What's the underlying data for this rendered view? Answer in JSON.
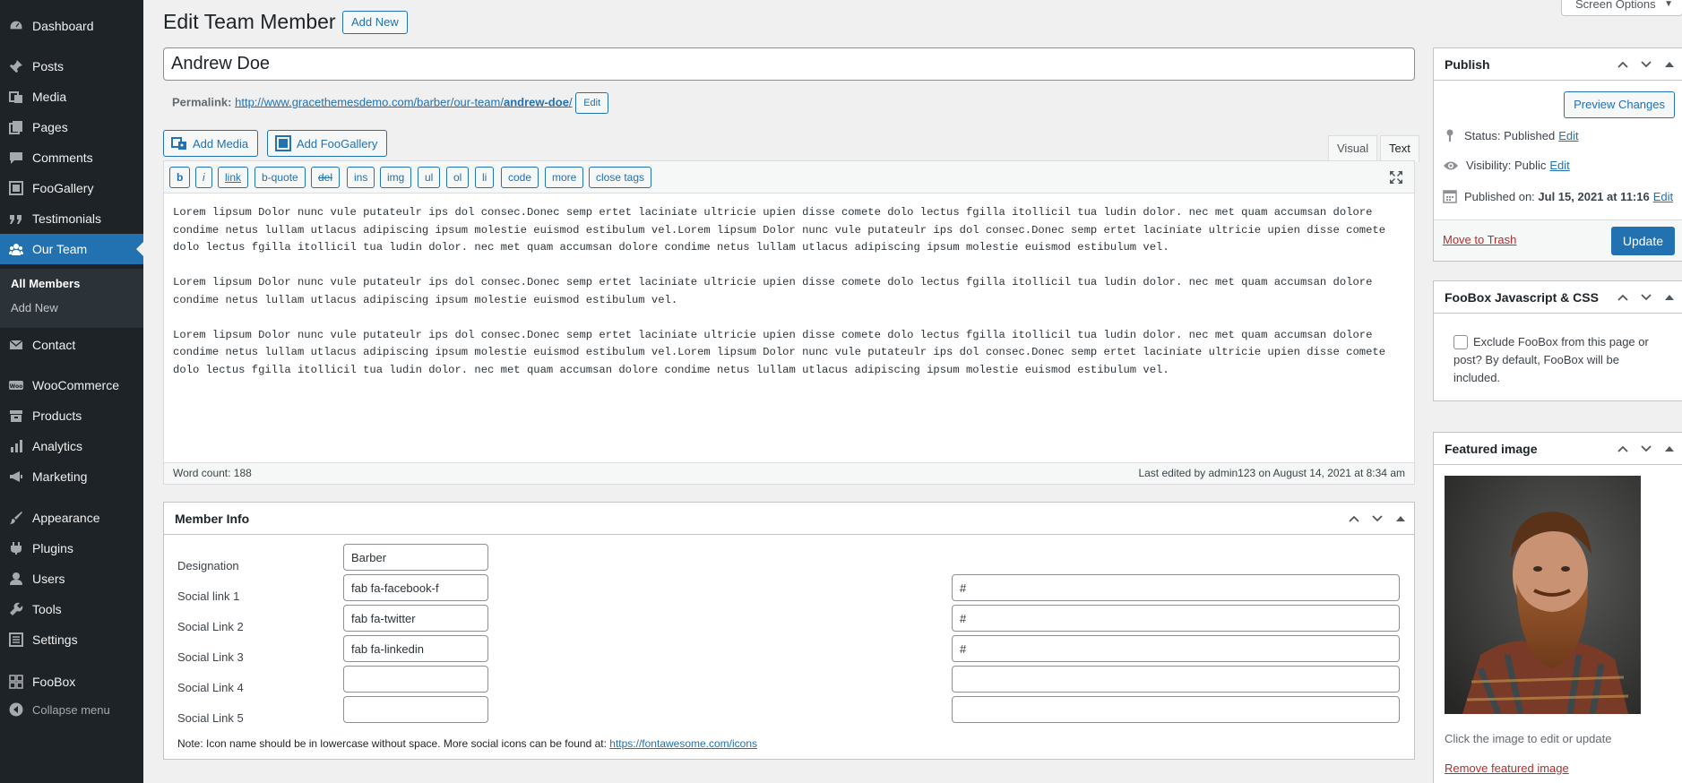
{
  "sidebar": {
    "items": [
      {
        "label": "Dashboard",
        "icon": "dashboard-icon"
      },
      {
        "label": "Posts",
        "icon": "pin-icon"
      },
      {
        "label": "Media",
        "icon": "media-icon"
      },
      {
        "label": "Pages",
        "icon": "page-icon"
      },
      {
        "label": "Comments",
        "icon": "comment-icon"
      },
      {
        "label": "FooGallery",
        "icon": "gallery-icon"
      },
      {
        "label": "Testimonials",
        "icon": "quote-icon"
      },
      {
        "label": "Our Team",
        "icon": "group-icon"
      },
      {
        "label": "Contact",
        "icon": "mail-icon"
      },
      {
        "label": "WooCommerce",
        "icon": "woo-icon"
      },
      {
        "label": "Products",
        "icon": "archive-icon"
      },
      {
        "label": "Analytics",
        "icon": "chart-bar-icon"
      },
      {
        "label": "Marketing",
        "icon": "megaphone-icon"
      },
      {
        "label": "Appearance",
        "icon": "brush-icon"
      },
      {
        "label": "Plugins",
        "icon": "plugin-icon"
      },
      {
        "label": "Users",
        "icon": "user-icon"
      },
      {
        "label": "Tools",
        "icon": "wrench-icon"
      },
      {
        "label": "Settings",
        "icon": "settings-icon"
      },
      {
        "label": "FooBox",
        "icon": "grid-icon"
      }
    ],
    "submenu": {
      "all_members": "All Members",
      "add_new": "Add New"
    },
    "collapse": "Collapse menu"
  },
  "header": {
    "title": "Edit Team Member",
    "add_new": "Add New",
    "screen_options": "Screen Options"
  },
  "post": {
    "title": "Andrew Doe",
    "permalink_label": "Permalink:",
    "permalink_base": "http://www.gracethemesdemo.com/barber/our-team/",
    "permalink_slug": "andrew-doe",
    "permalink_tail": "/",
    "edit": "Edit"
  },
  "media_buttons": {
    "add_media": "Add Media",
    "add_foogallery": "Add FooGallery"
  },
  "editor": {
    "tabs": {
      "visual": "Visual",
      "text": "Text"
    },
    "quicktags": [
      "b",
      "i",
      "link",
      "b-quote",
      "del",
      "ins",
      "img",
      "ul",
      "ol",
      "li",
      "code",
      "more",
      "close tags"
    ],
    "paragraphs": [
      "Lorem lipsum Dolor nunc vule putateulr ips dol consec.Donec semp ertet laciniate ultricie upien disse comete dolo lectus fgilla itollicil tua ludin dolor. nec met quam accumsan dolore condime netus lullam utlacus adipiscing ipsum molestie euismod estibulum vel.Lorem lipsum Dolor nunc vule putateulr ips dol consec.Donec semp ertet laciniate ultricie upien disse comete dolo lectus fgilla itollicil tua ludin dolor. nec met quam accumsan dolore condime netus lullam utlacus adipiscing ipsum molestie euismod estibulum vel.",
      "Lorem lipsum Dolor nunc vule putateulr ips dol consec.Donec semp ertet laciniate ultricie upien disse comete dolo lectus fgilla itollicil tua ludin dolor. nec met quam accumsan dolore condime netus lullam utlacus adipiscing ipsum molestie euismod estibulum vel.",
      "Lorem lipsum Dolor nunc vule putateulr ips dol consec.Donec semp ertet laciniate ultricie upien disse comete dolo lectus fgilla itollicil tua ludin dolor. nec met quam accumsan dolore condime netus lullam utlacus adipiscing ipsum molestie euismod estibulum vel.Lorem lipsum Dolor nunc vule putateulr ips dol consec.Donec semp ertet laciniate ultricie upien disse comete dolo lectus fgilla itollicil tua ludin dolor. nec met quam accumsan dolore condime netus lullam utlacus adipiscing ipsum molestie euismod estibulum vel."
    ],
    "word_count": "Word count: 188",
    "last_edited": "Last edited by admin123 on August 14, 2021 at 8:34 am"
  },
  "member_info": {
    "title": "Member Info",
    "rows": [
      {
        "label": "Designation",
        "icon_value": "Barber",
        "link_value": null
      },
      {
        "label": "Social link 1",
        "icon_value": "fab fa-facebook-f",
        "link_value": "#"
      },
      {
        "label": "Social Link 2",
        "icon_value": "fab fa-twitter",
        "link_value": "#"
      },
      {
        "label": "Social Link 3",
        "icon_value": "fab fa-linkedin",
        "link_value": "#"
      },
      {
        "label": "Social Link 4",
        "icon_value": "",
        "link_value": ""
      },
      {
        "label": "Social Link 5",
        "icon_value": "",
        "link_value": ""
      }
    ],
    "note_prefix": "Note: Icon name should be in lowercase without space. More social icons can be found at: ",
    "note_link": "https://fontawesome.com/icons"
  },
  "publish": {
    "title": "Publish",
    "preview": "Preview Changes",
    "status_label": "Status:",
    "status_value": "Published",
    "visibility_label": "Visibility:",
    "visibility_value": "Public",
    "published_label": "Published on:",
    "published_value": "Jul 15, 2021 at 11:16",
    "edit": "Edit",
    "trash": "Move to Trash",
    "update": "Update"
  },
  "foobox": {
    "title": "FooBox Javascript & CSS",
    "checkbox_label": "Exclude FooBox from this page or post? By default, FooBox will be included.",
    "checked": false
  },
  "featured": {
    "title": "Featured image",
    "caption": "Click the image to edit or update",
    "remove": "Remove featured image"
  },
  "colors": {
    "sidebar_bg": "#1d2327",
    "accent": "#2271b1",
    "danger": "#b32d2e",
    "page_bg": "#f0f0f1"
  }
}
